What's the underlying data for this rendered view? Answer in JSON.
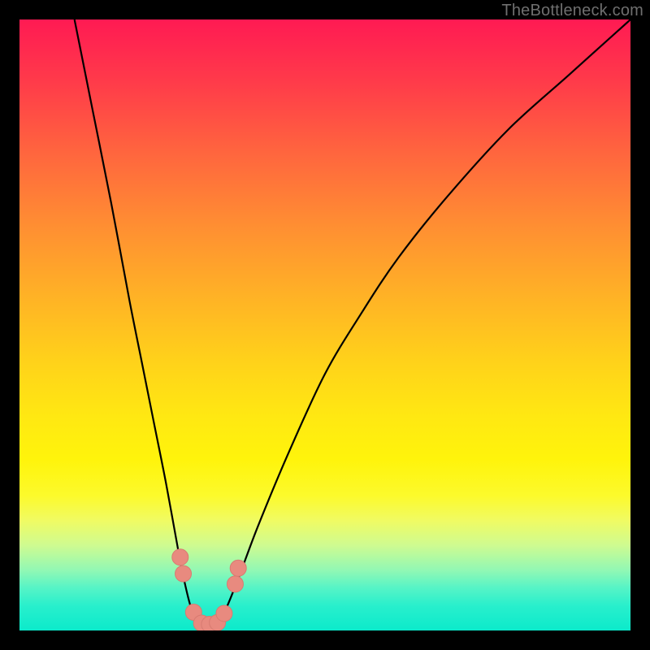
{
  "watermark": "TheBottleneck.com",
  "chart_data": {
    "type": "line",
    "title": "",
    "xlabel": "",
    "ylabel": "",
    "xlim": [
      0,
      100
    ],
    "ylim": [
      0,
      100
    ],
    "series": [
      {
        "name": "bottleneck-curve",
        "x": [
          9,
          12,
          15,
          18,
          20,
          22,
          24,
          26,
          27,
          28,
          29,
          30,
          31,
          32,
          33,
          34,
          36,
          39,
          44,
          50,
          56,
          62,
          70,
          80,
          90,
          100
        ],
        "values": [
          100,
          85,
          70,
          54,
          44,
          34,
          24,
          13,
          8,
          4,
          2,
          1,
          1,
          1,
          2,
          4,
          9,
          17,
          29,
          42,
          52,
          61,
          71,
          82,
          91,
          100
        ]
      }
    ],
    "markers": [
      {
        "name": "dot-left-upper",
        "x": 26.3,
        "y": 12.0
      },
      {
        "name": "dot-left-lower",
        "x": 26.8,
        "y": 9.3
      },
      {
        "name": "dot-bottom-1",
        "x": 28.5,
        "y": 3.0
      },
      {
        "name": "dot-bottom-2",
        "x": 29.8,
        "y": 1.2
      },
      {
        "name": "dot-bottom-3",
        "x": 31.1,
        "y": 1.0
      },
      {
        "name": "dot-bottom-4",
        "x": 32.4,
        "y": 1.3
      },
      {
        "name": "dot-bottom-5",
        "x": 33.5,
        "y": 2.8
      },
      {
        "name": "dot-right-lower",
        "x": 35.3,
        "y": 7.6
      },
      {
        "name": "dot-right-upper",
        "x": 35.8,
        "y": 10.2
      }
    ],
    "colors": {
      "curve_stroke": "#000000",
      "marker_fill": "#e88a7f",
      "marker_stroke": "#d87b71"
    }
  }
}
